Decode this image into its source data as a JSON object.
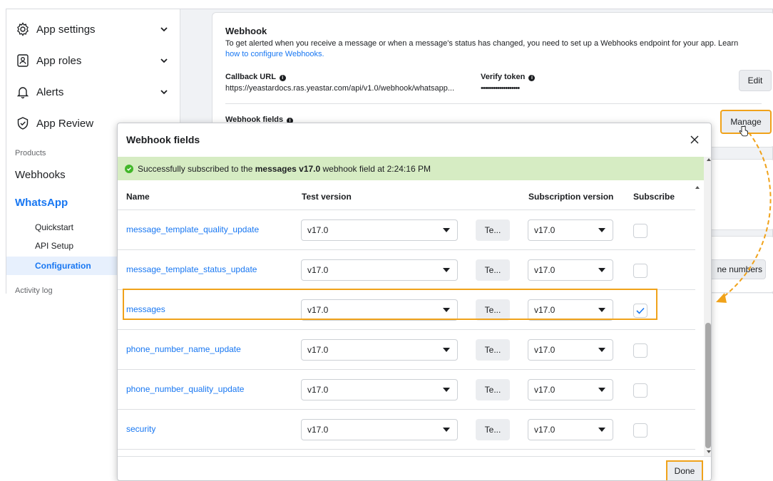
{
  "sidebar": {
    "items": [
      {
        "label": "App settings",
        "icon": "gear-icon"
      },
      {
        "label": "App roles",
        "icon": "id-badge-icon"
      },
      {
        "label": "Alerts",
        "icon": "bell-icon"
      },
      {
        "label": "App Review",
        "icon": "shield-check-icon"
      }
    ],
    "products_label": "Products",
    "webhooks_label": "Webhooks",
    "whatsapp_label": "WhatsApp",
    "subitems": [
      "Quickstart",
      "API Setup",
      "Configuration"
    ],
    "activity_log_label": "Activity log"
  },
  "webhook": {
    "title": "Webhook",
    "description": "To get alerted when you receive a message or when a message's status has changed, you need to set up a Webhooks endpoint for your app. Learn",
    "link_text": "how to configure Webhooks.",
    "callback_label": "Callback URL",
    "callback_value": "https://yeastardocs.ras.yeastar.com/api/v1.0/webhook/whatsapp...",
    "verify_label": "Verify token",
    "verify_value": "•••••••••••••••••••",
    "edit_label": "Edit",
    "fields_label": "Webhook fields",
    "manage_label": "Manage",
    "phone_numbers_btn": "ne numbers"
  },
  "modal": {
    "title": "Webhook fields",
    "banner_prefix": "Successfully subscribed to the ",
    "banner_bold": "messages v17.0",
    "banner_suffix": " webhook field at 2:24:16 PM",
    "columns": {
      "name": "Name",
      "test_version": "Test version",
      "subscription_version": "Subscription version",
      "subscribe": "Subscribe"
    },
    "rows": [
      {
        "name": "message_template_quality_update",
        "test_version": "v17.0",
        "test_label": "Te...",
        "subscription_version": "v17.0",
        "subscribed": false
      },
      {
        "name": "message_template_status_update",
        "test_version": "v17.0",
        "test_label": "Te...",
        "subscription_version": "v17.0",
        "subscribed": false
      },
      {
        "name": "messages",
        "test_version": "v17.0",
        "test_label": "Te...",
        "subscription_version": "v17.0",
        "subscribed": true
      },
      {
        "name": "phone_number_name_update",
        "test_version": "v17.0",
        "test_label": "Te...",
        "subscription_version": "v17.0",
        "subscribed": false
      },
      {
        "name": "phone_number_quality_update",
        "test_version": "v17.0",
        "test_label": "Te...",
        "subscription_version": "v17.0",
        "subscribed": false
      },
      {
        "name": "security",
        "test_version": "v17.0",
        "test_label": "Te...",
        "subscription_version": "v17.0",
        "subscribed": false
      }
    ],
    "done_label": "Done"
  },
  "colors": {
    "accent": "#1877f2",
    "highlight": "#f0a21a",
    "success_bg": "#d6ecc3",
    "success_icon": "#42b72a"
  }
}
